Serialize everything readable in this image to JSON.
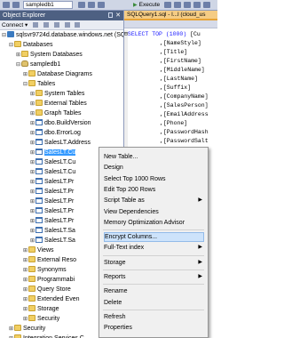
{
  "toolbar": {
    "database": "sampledb1",
    "execute": "Execute"
  },
  "explorer": {
    "title": "Object Explorer",
    "connect": "Connect ▾",
    "nodes": [
      {
        "label": "sqlsvr9724d.database.windows.net (SQ",
        "indent": 0,
        "expand": "⊟",
        "icon": "server-icon",
        "selected": false
      },
      {
        "label": "Databases",
        "indent": 1,
        "expand": "⊟",
        "icon": "folder-icon",
        "selected": false
      },
      {
        "label": "System Databases",
        "indent": 2,
        "expand": "⊞",
        "icon": "folder-icon",
        "selected": false
      },
      {
        "label": "sampledb1",
        "indent": 2,
        "expand": "⊟",
        "icon": "database-icon",
        "selected": false
      },
      {
        "label": "Database Diagrams",
        "indent": 3,
        "expand": "⊞",
        "icon": "folder-icon",
        "selected": false
      },
      {
        "label": "Tables",
        "indent": 3,
        "expand": "⊟",
        "icon": "folder-icon",
        "selected": false
      },
      {
        "label": "System Tables",
        "indent": 4,
        "expand": "⊞",
        "icon": "folder-icon",
        "selected": false
      },
      {
        "label": "External Tables",
        "indent": 4,
        "expand": "⊞",
        "icon": "folder-icon",
        "selected": false
      },
      {
        "label": "Graph Tables",
        "indent": 4,
        "expand": "⊞",
        "icon": "folder-icon",
        "selected": false
      },
      {
        "label": "dbo.BuildVersion",
        "indent": 4,
        "expand": "⊞",
        "icon": "table-icon",
        "selected": false
      },
      {
        "label": "dbo.ErrorLog",
        "indent": 4,
        "expand": "⊞",
        "icon": "table-icon",
        "selected": false
      },
      {
        "label": "SalesLT.Address",
        "indent": 4,
        "expand": "⊞",
        "icon": "table-icon",
        "selected": false
      },
      {
        "label": "SalesLT.Cu",
        "indent": 4,
        "expand": "⊞",
        "icon": "table-icon",
        "selected": true
      },
      {
        "label": "SalesLT.Cu",
        "indent": 4,
        "expand": "⊞",
        "icon": "table-icon",
        "selected": false
      },
      {
        "label": "SalesLT.Cu",
        "indent": 4,
        "expand": "⊞",
        "icon": "table-icon",
        "selected": false
      },
      {
        "label": "SalesLT.Pr",
        "indent": 4,
        "expand": "⊞",
        "icon": "table-icon",
        "selected": false
      },
      {
        "label": "SalesLT.Pr",
        "indent": 4,
        "expand": "⊞",
        "icon": "table-icon",
        "selected": false
      },
      {
        "label": "SalesLT.Pr",
        "indent": 4,
        "expand": "⊞",
        "icon": "table-icon",
        "selected": false
      },
      {
        "label": "SalesLT.Pr",
        "indent": 4,
        "expand": "⊞",
        "icon": "table-icon",
        "selected": false
      },
      {
        "label": "SalesLT.Pr",
        "indent": 4,
        "expand": "⊞",
        "icon": "table-icon",
        "selected": false
      },
      {
        "label": "SalesLT.Sa",
        "indent": 4,
        "expand": "⊞",
        "icon": "table-icon",
        "selected": false
      },
      {
        "label": "SalesLT.Sa",
        "indent": 4,
        "expand": "⊞",
        "icon": "table-icon",
        "selected": false
      },
      {
        "label": "Views",
        "indent": 3,
        "expand": "⊞",
        "icon": "folder-icon",
        "selected": false
      },
      {
        "label": "External Reso",
        "indent": 3,
        "expand": "⊞",
        "icon": "folder-icon",
        "selected": false
      },
      {
        "label": "Synonyms",
        "indent": 3,
        "expand": "⊞",
        "icon": "folder-icon",
        "selected": false
      },
      {
        "label": "Programmabi",
        "indent": 3,
        "expand": "⊞",
        "icon": "folder-icon",
        "selected": false
      },
      {
        "label": "Query Store",
        "indent": 3,
        "expand": "⊞",
        "icon": "folder-icon",
        "selected": false
      },
      {
        "label": "Extended Even",
        "indent": 3,
        "expand": "⊞",
        "icon": "folder-icon",
        "selected": false
      },
      {
        "label": "Storage",
        "indent": 3,
        "expand": "⊞",
        "icon": "folder-icon",
        "selected": false
      },
      {
        "label": "Security",
        "indent": 3,
        "expand": "⊞",
        "icon": "folder-icon",
        "selected": false
      },
      {
        "label": "Security",
        "indent": 1,
        "expand": "⊞",
        "icon": "folder-icon",
        "selected": false
      },
      {
        "label": "Integration Services C",
        "indent": 1,
        "expand": "⊞",
        "icon": "folder-icon",
        "selected": false
      }
    ]
  },
  "editor": {
    "tab": "SQLQuery1.sql - l...l (cloud_us",
    "lines": [
      {
        "prefix": "⊟",
        "kw": "SELECT TOP (1000)",
        "text": " [Cu"
      },
      {
        "prefix": "",
        "kw": "",
        "text": ",[NameStyle]"
      },
      {
        "prefix": "",
        "kw": "",
        "text": ",[Title]"
      },
      {
        "prefix": "",
        "kw": "",
        "text": ",[FirstName]"
      },
      {
        "prefix": "",
        "kw": "",
        "text": ",[MiddleName]"
      },
      {
        "prefix": "",
        "kw": "",
        "text": ",[LastName]"
      },
      {
        "prefix": "",
        "kw": "",
        "text": ",[Suffix]"
      },
      {
        "prefix": "",
        "kw": "",
        "text": ",[CompanyName]"
      },
      {
        "prefix": "",
        "kw": "",
        "text": ",[SalesPerson]"
      },
      {
        "prefix": "",
        "kw": "",
        "text": ",[EmailAddress"
      },
      {
        "prefix": "",
        "kw": "",
        "text": ",[Phone]"
      },
      {
        "prefix": "",
        "kw": "",
        "text": ",[PasswordHash"
      },
      {
        "prefix": "",
        "kw": "",
        "text": ",[PasswordSalt"
      },
      {
        "prefix": "",
        "kw": "",
        "text": ",[rowguid]"
      },
      {
        "prefix": "",
        "kw": "",
        "text": ",[ModifiedDate"
      },
      {
        "prefix": "",
        "kw": "FROM",
        "text": " [SalesLT].[Cu"
      }
    ],
    "bottom_label": "yle"
  },
  "context_menu": {
    "items": [
      {
        "label": "New Table...",
        "submenu": false,
        "highlight": false,
        "sep_before": false
      },
      {
        "label": "Design",
        "submenu": false,
        "highlight": false,
        "sep_before": false
      },
      {
        "label": "Select Top 1000 Rows",
        "submenu": false,
        "highlight": false,
        "sep_before": false
      },
      {
        "label": "Edit Top 200 Rows",
        "submenu": false,
        "highlight": false,
        "sep_before": false
      },
      {
        "label": "Script Table as",
        "submenu": true,
        "highlight": false,
        "sep_before": false
      },
      {
        "label": "View Dependencies",
        "submenu": false,
        "highlight": false,
        "sep_before": false
      },
      {
        "label": "Memory Optimization Advisor",
        "submenu": false,
        "highlight": false,
        "sep_before": false
      },
      {
        "label": "Encrypt Columns...",
        "submenu": false,
        "highlight": true,
        "sep_before": true
      },
      {
        "label": "Full-Text index",
        "submenu": true,
        "highlight": false,
        "sep_before": false
      },
      {
        "label": "Storage",
        "submenu": true,
        "highlight": false,
        "sep_before": true
      },
      {
        "label": "Reports",
        "submenu": true,
        "highlight": false,
        "sep_before": true
      },
      {
        "label": "Rename",
        "submenu": false,
        "highlight": false,
        "sep_before": true
      },
      {
        "label": "Delete",
        "submenu": false,
        "highlight": false,
        "sep_before": false
      },
      {
        "label": "Refresh",
        "submenu": false,
        "highlight": false,
        "sep_before": true
      },
      {
        "label": "Properties",
        "submenu": false,
        "highlight": false,
        "sep_before": false
      }
    ]
  }
}
